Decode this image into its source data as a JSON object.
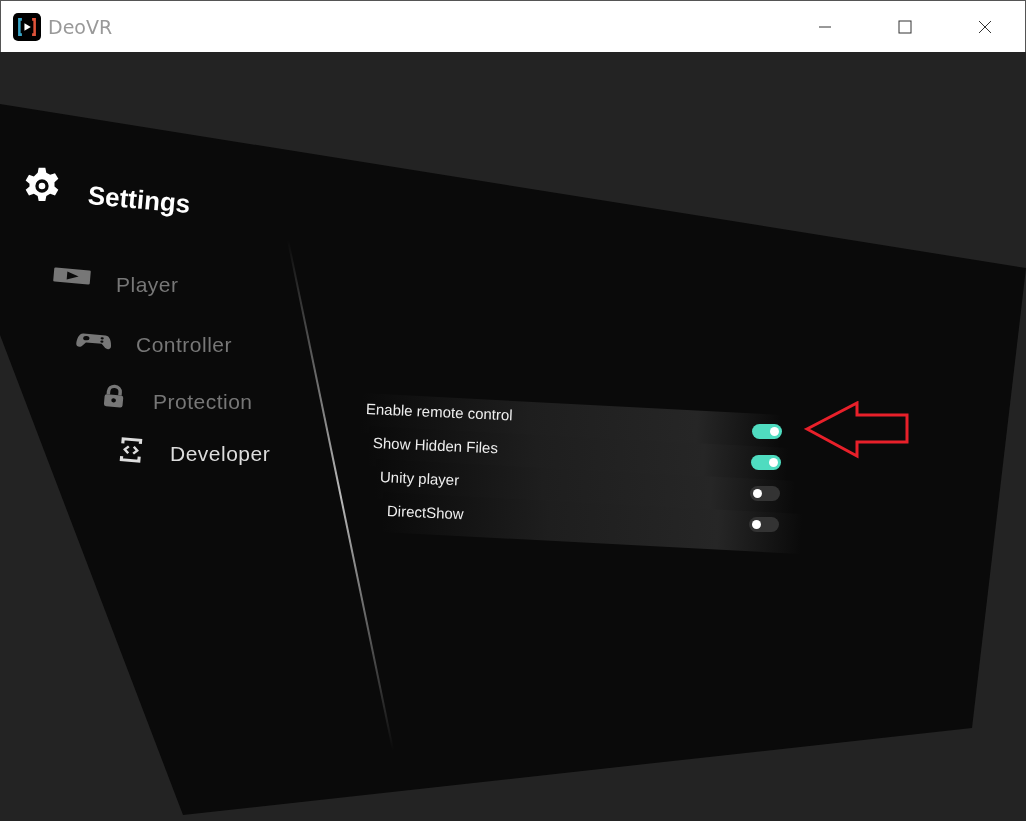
{
  "window": {
    "title": "DeoVR"
  },
  "settings": {
    "title": "Settings"
  },
  "menu": [
    {
      "label": "Player",
      "selected": false
    },
    {
      "label": "Controller",
      "selected": false
    },
    {
      "label": "Protection",
      "selected": false
    },
    {
      "label": "Developer",
      "selected": true
    }
  ],
  "options": [
    {
      "label": "Enable remote control",
      "on": true
    },
    {
      "label": "Show Hidden Files",
      "on": true
    },
    {
      "label": "Unity player",
      "on": false
    },
    {
      "label": "DirectShow",
      "on": false
    }
  ]
}
